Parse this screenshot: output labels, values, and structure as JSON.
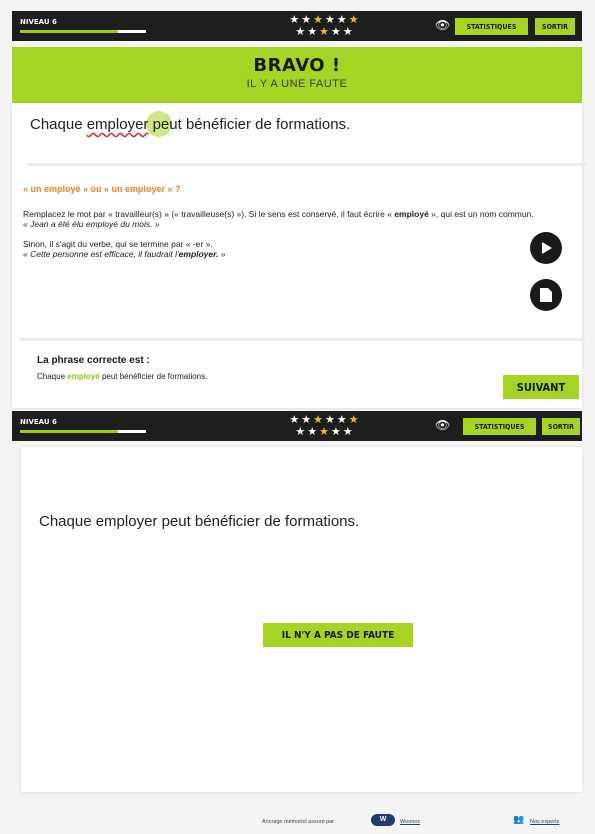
{
  "topbar": {
    "level_label": "NIVEAU 6",
    "level_progress": 0.78,
    "stars": [
      "off",
      "off",
      "on",
      "off",
      "off",
      "on",
      "off",
      "off",
      "on",
      "off",
      "off"
    ],
    "eye_icon": "eye-icon",
    "stats_label": "STATISTIQUES",
    "exit_label": "SORTIR"
  },
  "result": {
    "title": "BRAVO !",
    "subtitle": "IL Y A UNE FAUTE"
  },
  "sentence": {
    "before": "Chaque ",
    "error_word": "employer",
    "after": " peut bénéficier de formations."
  },
  "explanation": {
    "question": "« un employé » ou « un employer » ?",
    "p1_a": "Remplacez le mot par « travailleur(s) » (« travailleuse(s) »). Si le sens est conservé, il faut écrire « ",
    "p1_bold": "employé",
    "p1_b": " », qui est un nom commun.",
    "p1_example": "« Jean a été élu employé du mois. »",
    "p2": "Sinon, il s'agit du verbe, qui se termine par « -er ».",
    "p2_example_a": "« Cette personne est efficace, il faudrait l'",
    "p2_example_bold": "employer.",
    "p2_example_b": " »",
    "play_icon": "play-icon",
    "doc_icon": "document-icon"
  },
  "correction": {
    "title": "La phrase correcte est :",
    "before": "Chaque ",
    "keyword": "employé",
    "after": " peut bénéficier de formations.",
    "next_label": "SUIVANT"
  },
  "question2": {
    "sentence": "Chaque employer peut bénéficier de formations.",
    "no_error_label": "IL N'Y A PAS DE FAUTE"
  },
  "footer": {
    "text": "Ancrage mémoriel assuré par",
    "brand": "Woonoz",
    "experts": "Nos experts"
  },
  "colors": {
    "accent": "#a6d424",
    "topbar": "#1e1e1e",
    "orange": "#f07f1a",
    "error": "#d6262a"
  }
}
